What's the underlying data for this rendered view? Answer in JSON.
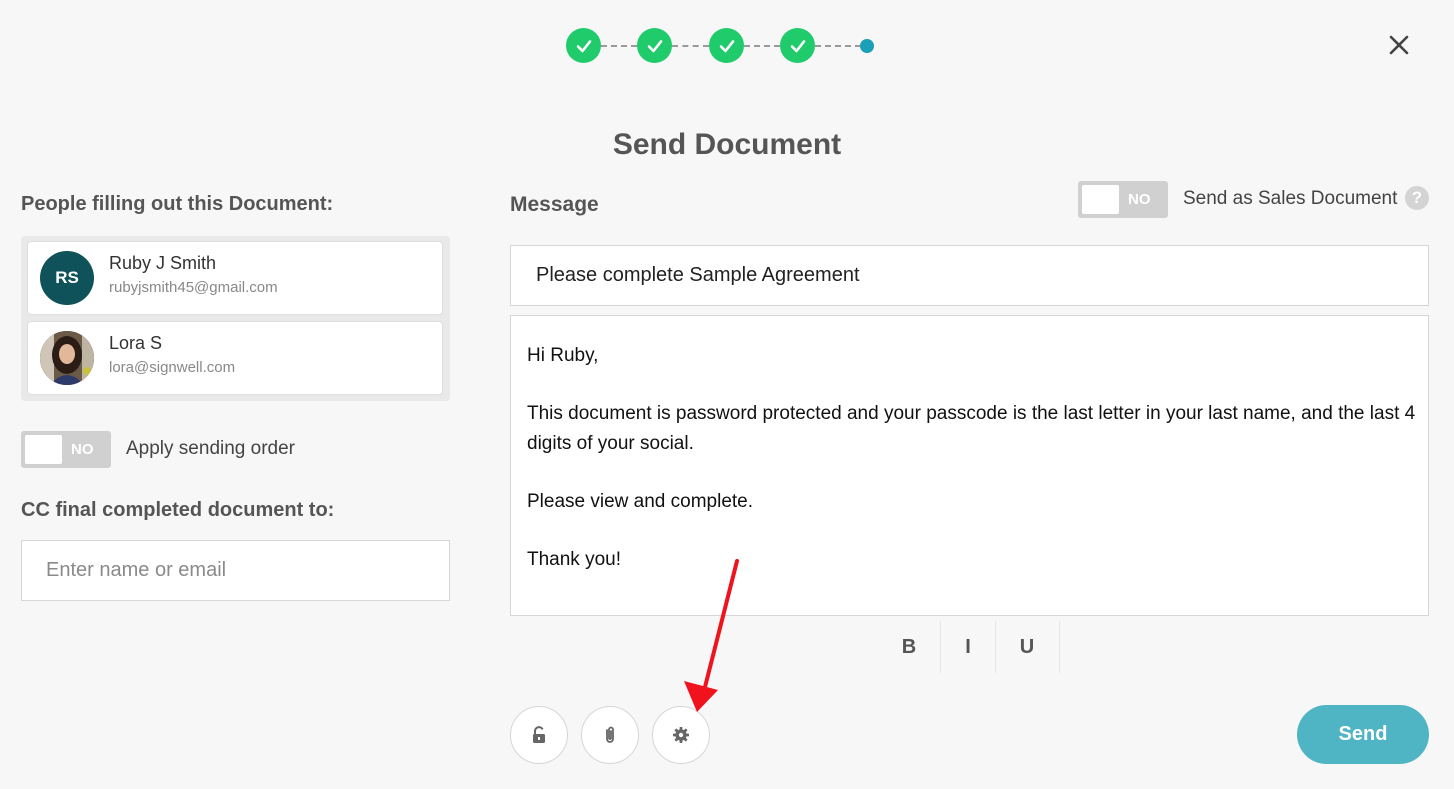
{
  "title": "Send Document",
  "stepper": {
    "completed_steps": 4,
    "total_steps": 5
  },
  "people": {
    "heading": "People filling out this Document:",
    "list": [
      {
        "initials": "RS",
        "name": "Ruby J Smith",
        "email": "rubyjsmith45@gmail.com"
      },
      {
        "initials": "",
        "name": "Lora S",
        "email": "lora@signwell.com"
      }
    ]
  },
  "sending_order": {
    "toggle_text": "NO",
    "label": "Apply sending order"
  },
  "cc": {
    "heading": "CC final completed document to:",
    "placeholder": "Enter name or email"
  },
  "message": {
    "label": "Message",
    "subject": "Please complete Sample Agreement",
    "body": [
      "Hi Ruby,",
      "This document is password protected and your passcode is the last letter in your last name, and the last 4 digits of your social.",
      "Please view and complete.",
      "Thank you!"
    ]
  },
  "sales_doc": {
    "toggle_text": "NO",
    "label": "Send as Sales Document",
    "help": "?"
  },
  "format": {
    "bold": "B",
    "italic": "I",
    "underline": "U"
  },
  "actions": {
    "send_label": "Send"
  },
  "colors": {
    "step_done": "#1fcb6b",
    "step_current": "#1b9fb7",
    "send": "#4fb4c3",
    "avatar": "#0f5259"
  }
}
